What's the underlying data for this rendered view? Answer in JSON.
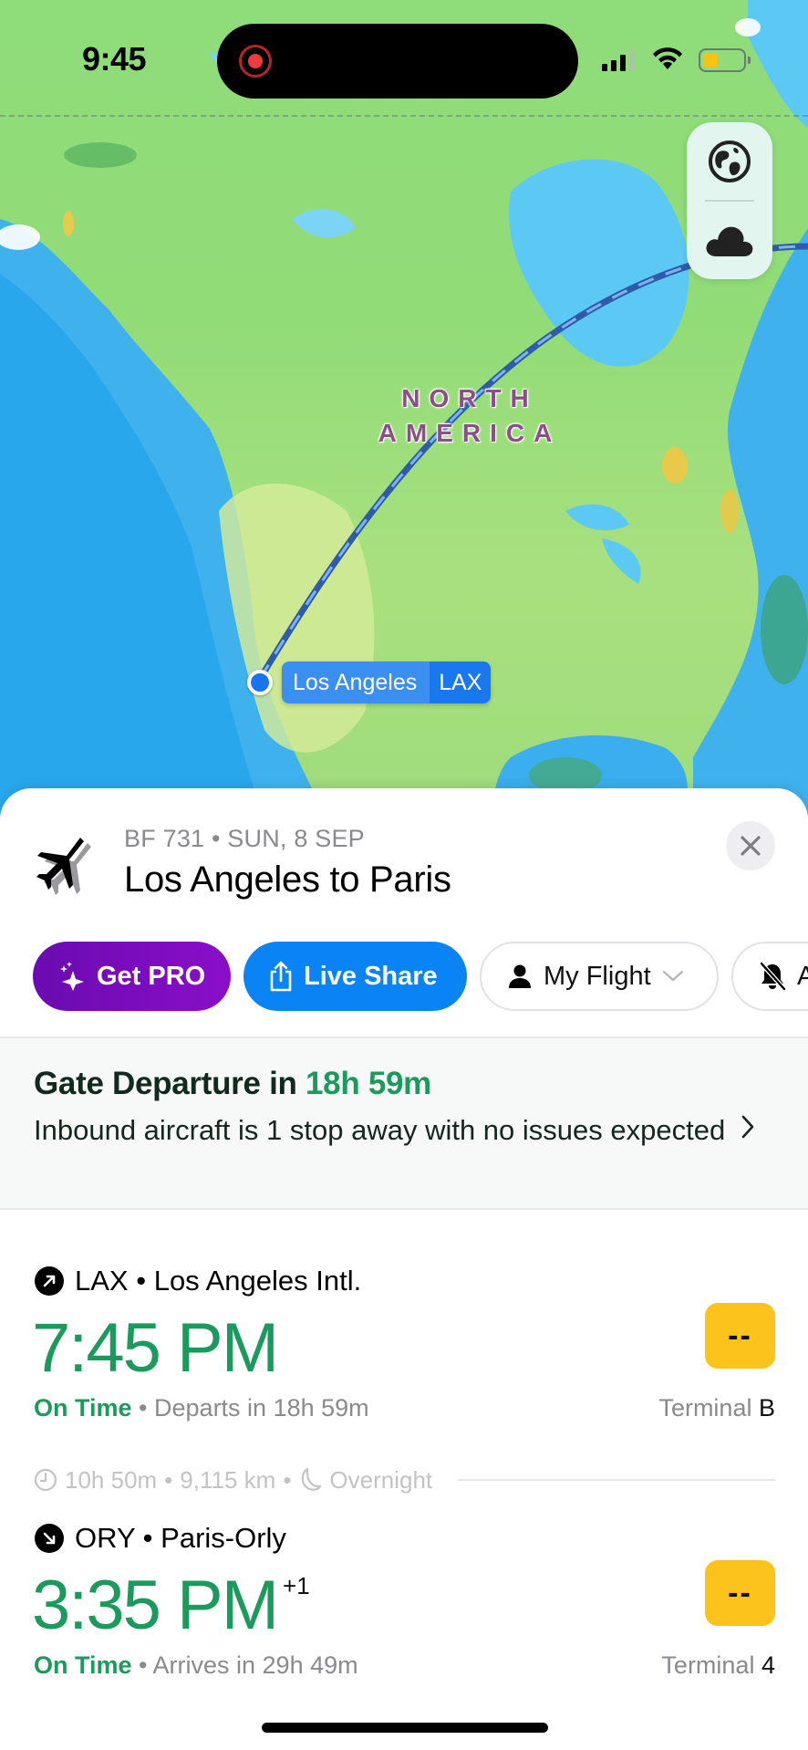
{
  "status_bar": {
    "time": "9:45",
    "recording": true,
    "battery_level": 0.3,
    "battery_color": "#f6c417"
  },
  "map": {
    "continent_label_line1": "NORTH",
    "continent_label_line2": "AMERICA",
    "origin_city": "Los Angeles",
    "origin_code": "LAX",
    "controls": [
      {
        "name": "globe-view",
        "icon": "globe-icon"
      },
      {
        "name": "weather-layer",
        "icon": "cloud-icon"
      }
    ]
  },
  "flight": {
    "meta": "BF 731 • SUN, 8 SEP",
    "title": "Los Angeles to Paris",
    "icon": "airplane-icon"
  },
  "actions": {
    "get_pro": "Get PRO",
    "live_share": "Live Share",
    "my_flight": "My Flight",
    "alerts": "Alerts"
  },
  "gate_banner": {
    "title_prefix": "Gate Departure in ",
    "title_time": "18h 59m",
    "description": "Inbound aircraft is 1 stop away with no issues expected"
  },
  "departure": {
    "airport_code": "LAX",
    "airport_name": "Los Angeles Intl.",
    "separator": " • ",
    "time": "7:45 PM",
    "status": "On Time",
    "status_detail": "Departs in 18h 59m",
    "gate": "--",
    "terminal_label": "Terminal",
    "terminal_value": "B"
  },
  "duration": {
    "time": "10h 50m",
    "distance": "9,115 km",
    "overnight": "Overnight"
  },
  "arrival": {
    "airport_code": "ORY",
    "airport_name": "Paris-Orly",
    "separator": " • ",
    "time": "3:35 PM",
    "day_offset": "+1",
    "status": "On Time",
    "status_detail": "Arrives in 29h 49m",
    "gate": "--",
    "terminal_label": "Terminal",
    "terminal_value": "4"
  },
  "colors": {
    "accent_green": "#1c9a5e",
    "pro_purple": "#7a0dbd",
    "share_blue": "#0a84f5",
    "gate_yellow": "#fbc31c"
  }
}
